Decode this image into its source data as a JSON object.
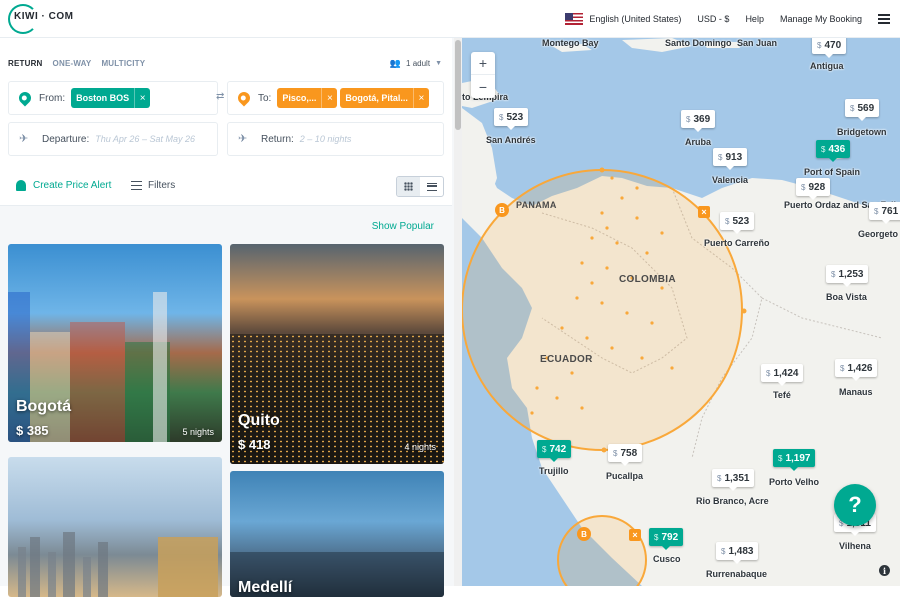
{
  "header": {
    "logo": "KIWI · COM",
    "language": "English (United States)",
    "currency": "USD - $",
    "help": "Help",
    "manage": "Manage My Booking"
  },
  "search": {
    "modes": [
      "RETURN",
      "ONE-WAY",
      "MULTICITY"
    ],
    "passengers": "1 adult",
    "from_label": "From:",
    "from_chip": "Boston BOS",
    "to_label": "To:",
    "to_chips": [
      "Pisco,...",
      "Bogotá, Pital..."
    ],
    "departure_label": "Departure:",
    "departure_value": "Thu Apr 26 – Sat May 26",
    "return_label": "Return:",
    "return_value": "2 – 10 nights",
    "price_alert": "Create Price Alert",
    "filters": "Filters",
    "show_popular": "Show Popular"
  },
  "cards": [
    {
      "city": "Bogotá",
      "price": "$ 385",
      "nights": "5 nights"
    },
    {
      "city": "Quito",
      "price": "$ 418",
      "nights": "4 nights"
    },
    {
      "city": "",
      "price": "",
      "nights": ""
    },
    {
      "city": "Medellí",
      "price": "",
      "nights": ""
    }
  ],
  "map": {
    "zoom_in": "+",
    "zoom_out": "−",
    "countries": [
      "COLOMBIA",
      "ECUADOR",
      "PANAMA"
    ],
    "places": [
      "Montego Bay",
      "Santo Domingo",
      "San Juan",
      "Antigua",
      "to Lempira",
      "San Andrés",
      "Aruba",
      "Valencia",
      "Bridgetown",
      "Port of Spain",
      "Puerto Ordaz and San Felix",
      "Georgeto",
      "Puerto Carreño",
      "Boa Vista",
      "Tefé",
      "Manaus",
      "Trujillo",
      "Pucallpa",
      "Porto Velho",
      "Rio Branco, Acre",
      "Vilhena",
      "Cusco",
      "Rurrenabaque"
    ],
    "prices": [
      {
        "value": "470",
        "green": false
      },
      {
        "value": "523",
        "green": false
      },
      {
        "value": "369",
        "green": false
      },
      {
        "value": "913",
        "green": false
      },
      {
        "value": "569",
        "green": false
      },
      {
        "value": "436",
        "green": true
      },
      {
        "value": "928",
        "green": false
      },
      {
        "value": "761",
        "green": false
      },
      {
        "value": "523",
        "green": false
      },
      {
        "value": "1,253",
        "green": false
      },
      {
        "value": "1,424",
        "green": false
      },
      {
        "value": "1,426",
        "green": false
      },
      {
        "value": "742",
        "green": true
      },
      {
        "value": "758",
        "green": false
      },
      {
        "value": "1,197",
        "green": true
      },
      {
        "value": "1,351",
        "green": false
      },
      {
        "value": "1,311",
        "green": false
      },
      {
        "value": "792",
        "green": true
      },
      {
        "value": "1,483",
        "green": false
      }
    ],
    "currency_symbol": "$",
    "help_button": "?",
    "info": "i",
    "marker_b": "B",
    "marker_x": "×"
  }
}
